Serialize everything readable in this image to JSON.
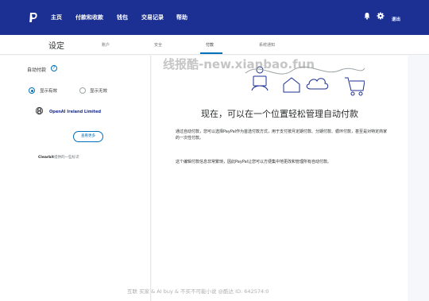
{
  "topnav": {
    "items": [
      "主页",
      "付款和收款",
      "钱包",
      "交易记录",
      "帮助"
    ],
    "logout": "退出",
    "icons": [
      "paypal-logo",
      "bell-icon",
      "gear-icon"
    ],
    "bg_color": "#1b3092"
  },
  "subnav": {
    "title": "设定",
    "tabs": [
      "账户",
      "安全",
      "付款",
      "系统通知"
    ],
    "active_tab": "付款"
  },
  "left": {
    "heading": "自动付款",
    "radio_active": "显示有效",
    "radio_inactive": "显示无效",
    "merchant": "OpenAI Ireland Limited",
    "more_button": "查看更多",
    "clearbit_brand": "Clearbit",
    "clearbit_rest": "提供的一些标识"
  },
  "main": {
    "title": "现在，可以在一个位置轻松管理自动付款",
    "para1": "通过自动付款，您可以选择PayPal作为首选付款方式，用于支付按月定期付款、分期付款、循环付款，甚至是对特定商家的一次性付款。",
    "para2": "这个编辑付款信息非常繁琐，因此PayPal让您可以方便集中地更改和管理所有自动付款。"
  },
  "watermark": "线报酷-new.xianbao.fun",
  "bottom_watermark": "互联 买家 & AI buy & 不买不可能小说 @酷达 ID: 642574:0",
  "accent_color": "#0070ba"
}
